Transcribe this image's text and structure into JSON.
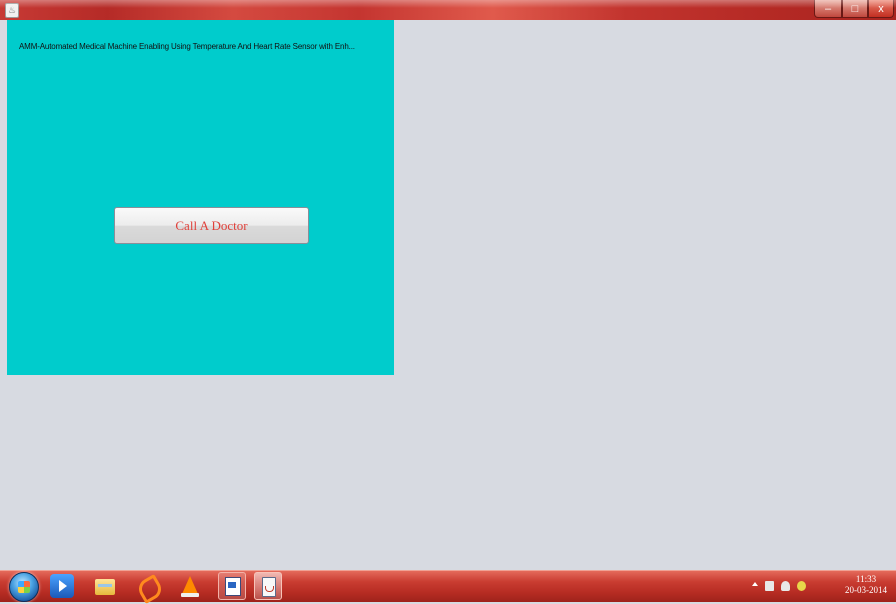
{
  "window": {
    "panel_title": "AMM-Automated Medical Machine Enabling Using Temperature And Heart Rate Sensor with Enh...",
    "call_button_label": "Call A Doctor",
    "controls": {
      "minimize": "–",
      "maximize": "□",
      "close": "x"
    }
  },
  "colors": {
    "panel_bg": "#00cccc",
    "window_bg": "#d7dae1",
    "button_text": "#e0403a",
    "titlebar": "#c43530",
    "taskbar": "#b62c23"
  },
  "taskbar": {
    "pinned": [
      "windows-media-player-icon",
      "file-explorer-icon",
      "nitro-icon",
      "vlc-icon",
      "notepad-icon",
      "java-icon"
    ],
    "clock": {
      "time": "11:33",
      "date": "20-03-2014"
    }
  }
}
